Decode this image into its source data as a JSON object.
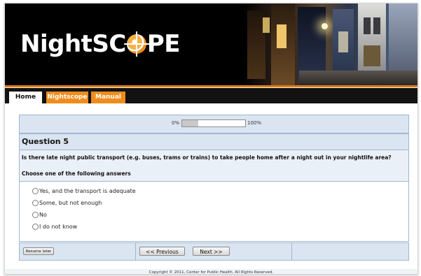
{
  "header": {
    "logo_text_before": "NightSC",
    "logo_text_after": "PE"
  },
  "tabs": [
    {
      "label": "Home",
      "active": true
    },
    {
      "label": "Nightscope",
      "active": false
    },
    {
      "label": "Manual",
      "active": false
    }
  ],
  "progress": {
    "start_label": "0%",
    "end_label": "100%",
    "value_fraction": 0.25
  },
  "question": {
    "title": "Question 5",
    "text": "Is there late night public transport (e.g. buses, trams or trains) to take people home after a night out in your nightlife area?",
    "help": "Choose one of the following answers",
    "answers": [
      "Yes, and the transport is adequate",
      "Some, but not enough",
      "No",
      "I do not know"
    ],
    "selected_index": null
  },
  "nav": {
    "resume_label": "Resume later",
    "previous_label": "<< Previous",
    "next_label": "Next >>"
  },
  "footer": {
    "copyright": "Copyright © 2011, Center for Public Health. All Rights Reserved."
  },
  "colors": {
    "brand_orange": "#f08c1c",
    "panel_blue": "#dbe5f1",
    "border_blue": "#9fb6cf"
  }
}
